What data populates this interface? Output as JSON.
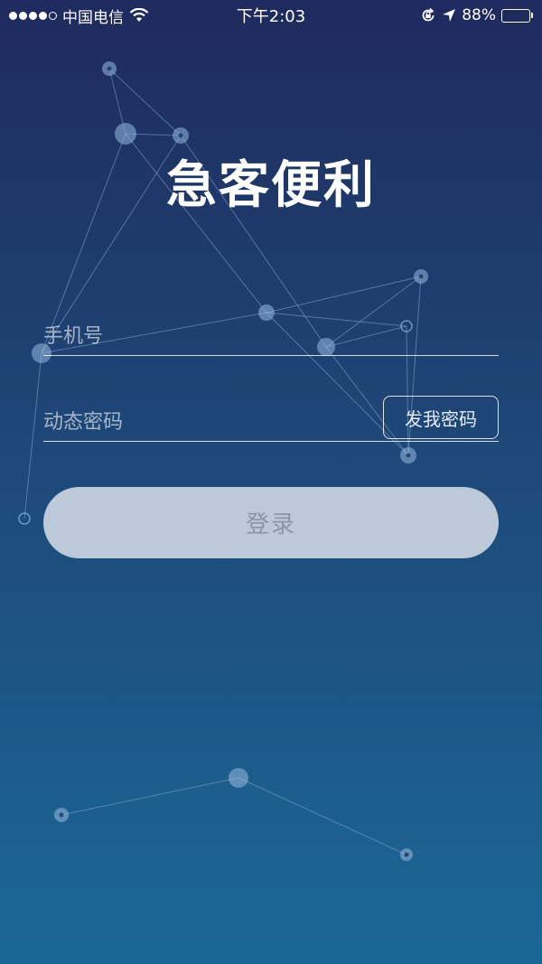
{
  "status_bar": {
    "carrier": "中国电信",
    "time": "下午2:03",
    "battery_text": "88%",
    "battery_level": 0.88,
    "icons": [
      "signal-dots-icon",
      "wifi-icon",
      "rotation-lock-icon",
      "location-arrow-icon",
      "battery-icon"
    ]
  },
  "app": {
    "title": "急客便利"
  },
  "form": {
    "phone_placeholder": "手机号",
    "phone_value": "",
    "code_placeholder": "动态密码",
    "code_value": "",
    "send_code_label": "发我密码",
    "login_label": "登录"
  },
  "colors": {
    "bg_top": "#1f2a5e",
    "bg_bottom": "#1b6896",
    "login_bg": "#bbc9d9",
    "login_text": "#8996a6",
    "battery_fill": "#4cd964"
  }
}
